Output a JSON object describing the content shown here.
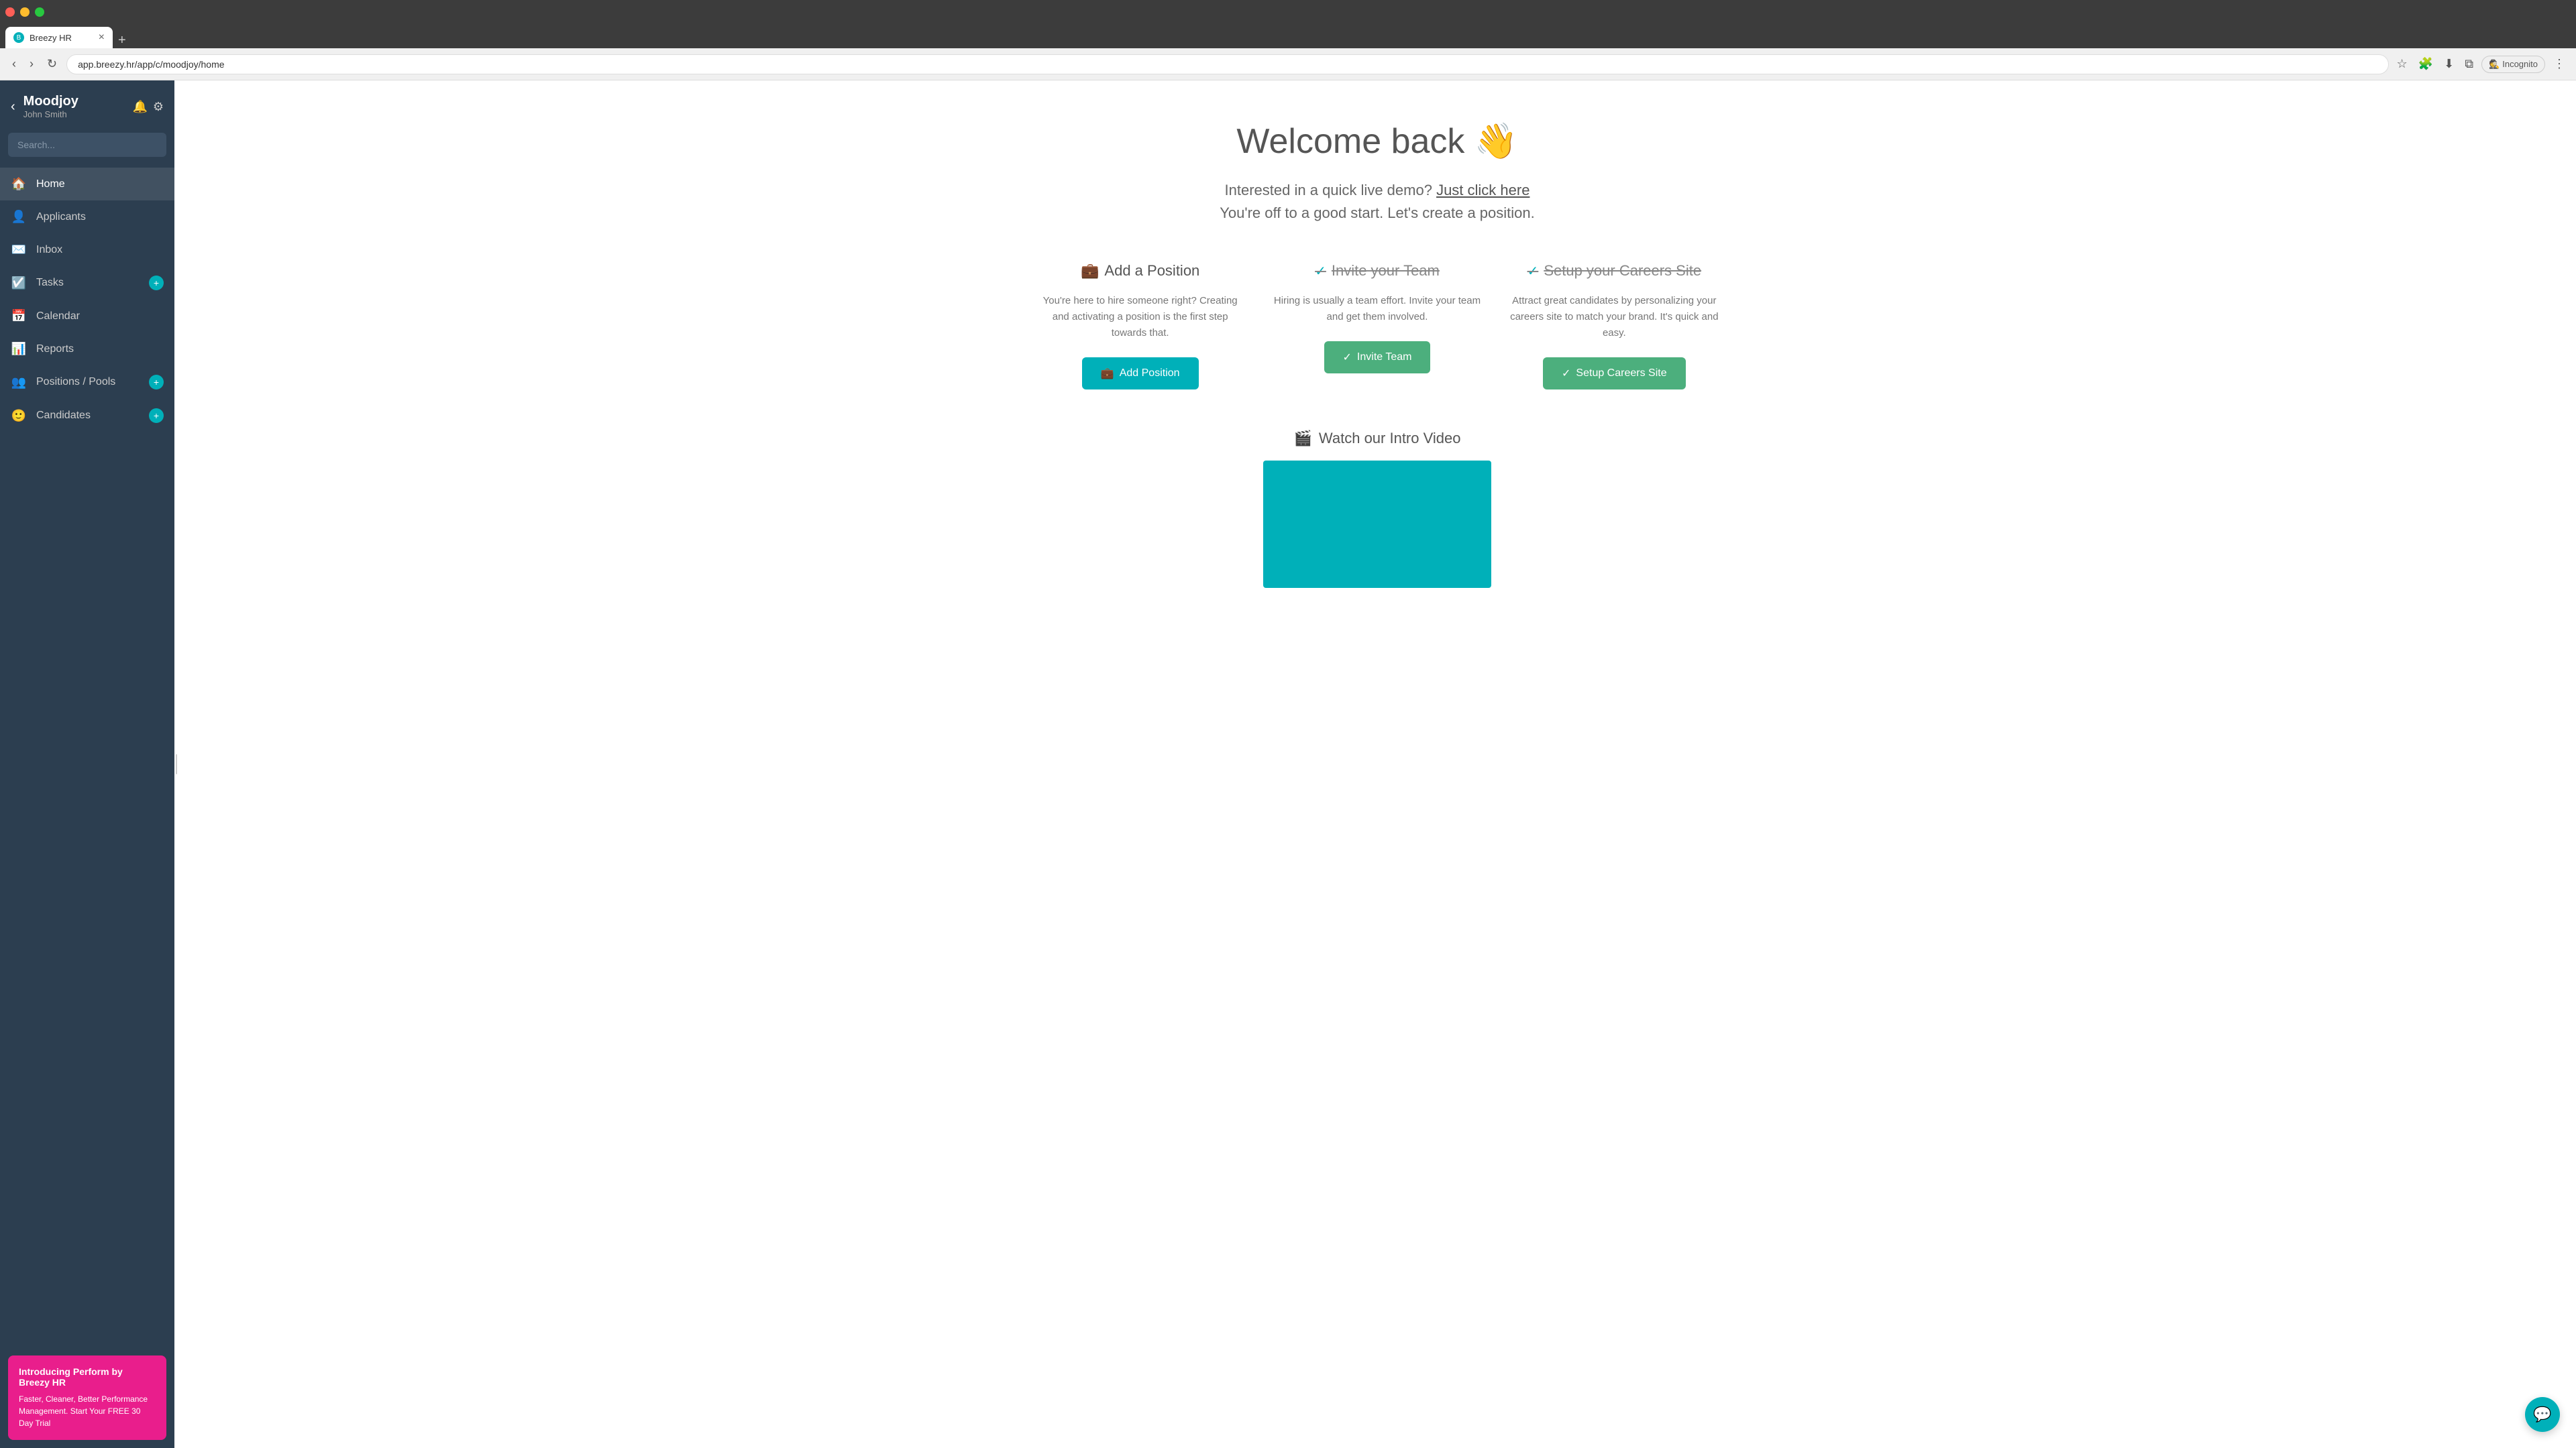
{
  "browser": {
    "tab_title": "Breezy HR",
    "url": "app.breezy.hr/app/c/moodjoy/home",
    "tab_icon": "B",
    "incognito_label": "Incognito"
  },
  "sidebar": {
    "company_name": "Moodjoy",
    "user_name": "John Smith",
    "search_placeholder": "Search...",
    "nav_items": [
      {
        "id": "home",
        "label": "Home",
        "icon": "🏠",
        "badge": null,
        "active": true
      },
      {
        "id": "applicants",
        "label": "Applicants",
        "icon": "👤",
        "badge": null,
        "active": false
      },
      {
        "id": "inbox",
        "label": "Inbox",
        "icon": "✉️",
        "badge": null,
        "active": false
      },
      {
        "id": "tasks",
        "label": "Tasks",
        "icon": "☑️",
        "badge": "+",
        "active": false
      },
      {
        "id": "calendar",
        "label": "Calendar",
        "icon": "📅",
        "badge": null,
        "active": false
      },
      {
        "id": "reports",
        "label": "Reports",
        "icon": "📊",
        "badge": null,
        "active": false
      },
      {
        "id": "positions-pools",
        "label": "Positions / Pools",
        "icon": "👥",
        "badge": "+",
        "active": false
      },
      {
        "id": "candidates",
        "label": "Candidates",
        "icon": "🙂",
        "badge": "+",
        "active": false
      }
    ],
    "promo": {
      "title": "Introducing Perform by Breezy HR",
      "text": "Faster, Cleaner, Better Performance Management. Start Your FREE 30 Day Trial"
    }
  },
  "main": {
    "welcome_title": "Welcome back 👋",
    "demo_text": "Interested in a quick live demo?",
    "demo_link": "Just click here",
    "start_text": "You're off to a good start. Let's create a position.",
    "cards": [
      {
        "id": "add-position",
        "icon": "💼",
        "title": "Add a Position",
        "completed": false,
        "desc": "You're here to hire someone right? Creating and activating a position is the first step towards that.",
        "btn_label": "Add Position",
        "btn_icon": "💼"
      },
      {
        "id": "invite-team",
        "icon": "✓",
        "title": "Invite your Team",
        "completed": true,
        "desc": "Hiring is usually a team effort. Invite your team and get them involved.",
        "btn_label": "Invite Team",
        "btn_icon": "✓"
      },
      {
        "id": "setup-careers",
        "icon": "✓",
        "title": "Setup your Careers Site",
        "completed": true,
        "desc": "Attract great candidates by personalizing your careers site to match your brand. It's quick and easy.",
        "btn_label": "Setup Careers Site",
        "btn_icon": "✓"
      }
    ],
    "video_section": {
      "icon": "🎬",
      "title": "Watch our Intro Video"
    }
  }
}
